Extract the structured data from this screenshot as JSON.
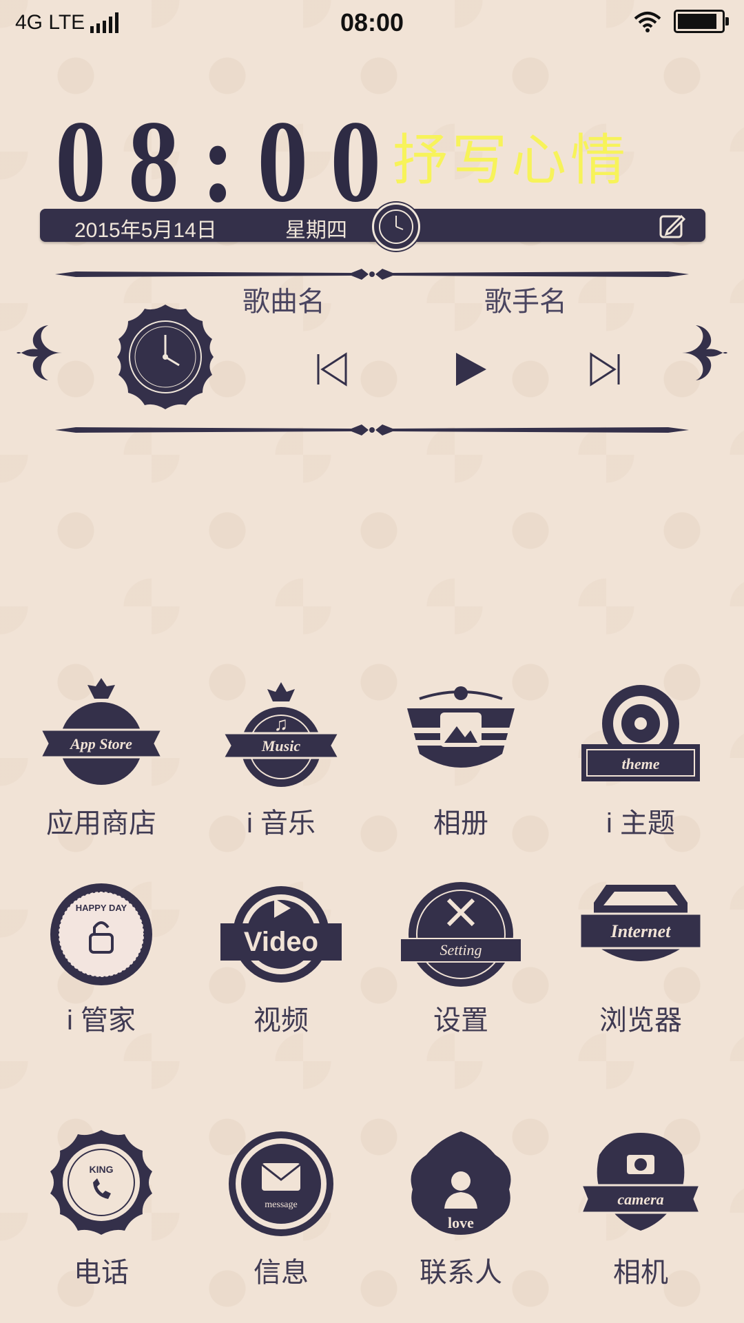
{
  "status_bar": {
    "network": "4G LTE",
    "time": "08:00",
    "wifi_icon": "wifi-icon",
    "battery_icon": "battery-icon",
    "battery_level": 1.0
  },
  "widget": {
    "clock": "08:00",
    "mood_prompt": "抒写心情",
    "date": "2015年5月14日",
    "weekday": "星期四",
    "edit_icon": "edit-icon"
  },
  "music": {
    "song_name": "歌曲名",
    "artist_name": "歌手名",
    "prev_icon": "skip-previous-icon",
    "play_icon": "play-icon",
    "next_icon": "skip-next-icon"
  },
  "apps": [
    {
      "label": "应用商店",
      "icon": "app-store-icon",
      "badge_text": "App Store"
    },
    {
      "label": "i 音乐",
      "icon": "music-icon",
      "badge_text": "Music"
    },
    {
      "label": "相册",
      "icon": "album-icon",
      "badge_text": ""
    },
    {
      "label": "i 主题",
      "icon": "theme-icon",
      "badge_text": "theme"
    },
    {
      "label": "i 管家",
      "icon": "manager-icon",
      "badge_text": "HAPPY DAY"
    },
    {
      "label": "视频",
      "icon": "video-icon",
      "badge_text": "Video"
    },
    {
      "label": "设置",
      "icon": "settings-icon",
      "badge_text": "Setting"
    },
    {
      "label": "浏览器",
      "icon": "browser-icon",
      "badge_text": "Internet"
    },
    {
      "label": "电话",
      "icon": "phone-icon",
      "badge_text": "KING"
    },
    {
      "label": "信息",
      "icon": "message-icon",
      "badge_text": "message"
    },
    {
      "label": "联系人",
      "icon": "contacts-icon",
      "badge_text": "love"
    },
    {
      "label": "相机",
      "icon": "camera-icon",
      "badge_text": "camera"
    }
  ],
  "colors": {
    "background": "#f1e3d6",
    "ink": "#34304a",
    "mood_text": "#f7f35a"
  }
}
